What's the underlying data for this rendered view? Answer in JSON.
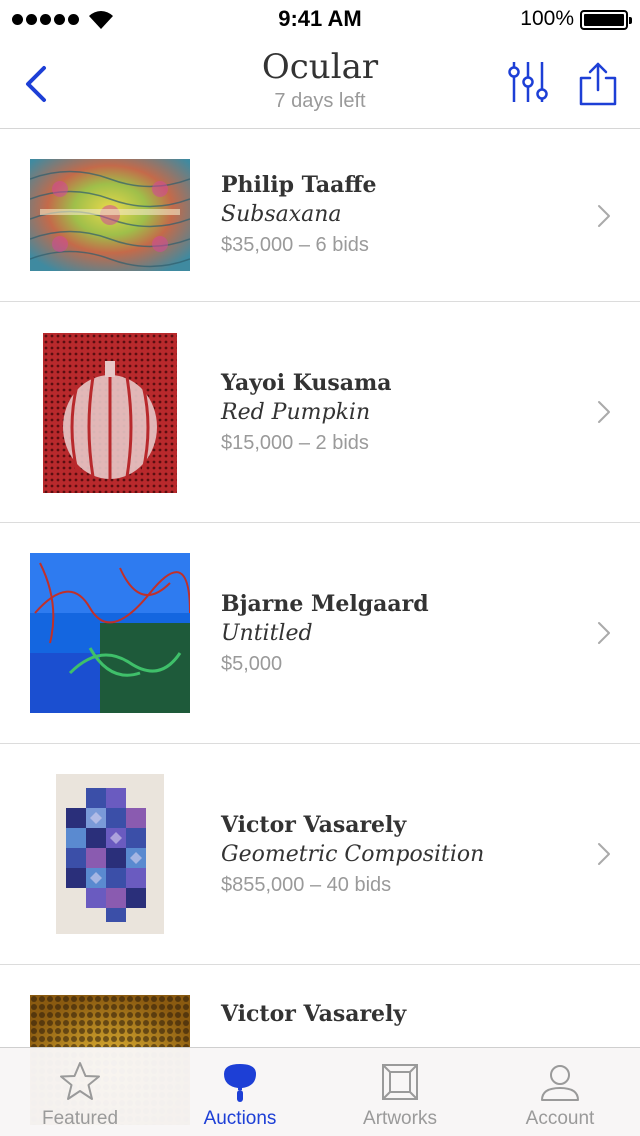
{
  "status_bar": {
    "time": "9:41 AM",
    "battery_percent": "100%"
  },
  "nav": {
    "title": "Ocular",
    "subtitle": "7 days left",
    "back_icon": "chevron-left-icon",
    "filter_icon": "sliders-icon",
    "share_icon": "share-icon"
  },
  "lots": [
    {
      "artist": "Philip Taaffe",
      "title": "Subsaxana",
      "price": "$35,000 – 6 bids"
    },
    {
      "artist": "Yayoi Kusama",
      "title": "Red Pumpkin",
      "price": "$15,000 – 2 bids"
    },
    {
      "artist": "Bjarne Melgaard",
      "title": "Untitled",
      "price": "$5,000"
    },
    {
      "artist": "Victor Vasarely",
      "title": "Geometric Composition",
      "price": "$855,000 – 40 bids"
    },
    {
      "artist": "Victor Vasarely",
      "title": "",
      "price": ""
    }
  ],
  "tabs": [
    {
      "label": "Featured",
      "icon": "star-icon",
      "active": false
    },
    {
      "label": "Auctions",
      "icon": "paddle-icon",
      "active": true
    },
    {
      "label": "Artworks",
      "icon": "frame-icon",
      "active": false
    },
    {
      "label": "Account",
      "icon": "person-icon",
      "active": false
    }
  ],
  "colors": {
    "accent": "#1d3fd6",
    "secondary_text": "#9a9a9a",
    "primary_text": "#333333",
    "separator": "#dcdcdc"
  }
}
